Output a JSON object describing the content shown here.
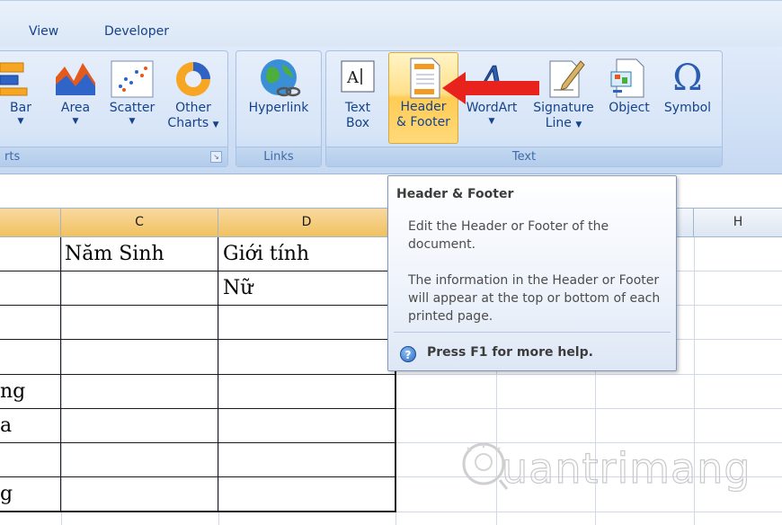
{
  "tabs": [
    "View",
    "Developer"
  ],
  "ribbon": {
    "charts_group": {
      "label": "rts",
      "buttons": [
        {
          "label": "Bar",
          "icon": "bar-chart-icon"
        },
        {
          "label": "Area",
          "icon": "area-chart-icon"
        },
        {
          "label": "Scatter",
          "icon": "scatter-chart-icon"
        },
        {
          "label": "Other",
          "label2": "Charts",
          "icon": "other-charts-icon"
        }
      ]
    },
    "links_group": {
      "label": "Links",
      "buttons": [
        {
          "label": "Hyperlink",
          "icon": "globe-link-icon"
        }
      ]
    },
    "text_group": {
      "label": "Text",
      "buttons": [
        {
          "label": "Text",
          "label2": "Box",
          "icon": "text-box-icon"
        },
        {
          "label": "Header",
          "label2": "& Footer",
          "icon": "header-footer-icon"
        },
        {
          "label": "WordArt",
          "icon": "wordart-icon"
        },
        {
          "label": "Signature",
          "label2": "Line",
          "icon": "signature-line-icon"
        },
        {
          "label": "Object",
          "icon": "object-icon"
        },
        {
          "label": "Symbol",
          "icon": "omega-icon",
          "glyph": "Ω"
        }
      ]
    }
  },
  "sheet": {
    "columns": [
      "C",
      "D",
      "H"
    ],
    "cells": {
      "c1": "Năm Sinh",
      "d1": "Giới tính",
      "d2": "Nữ",
      "a5": "ng",
      "a6": "a",
      "a8": "g"
    }
  },
  "tooltip": {
    "title": "Header & Footer",
    "body1": "Edit the Header or Footer of the document.",
    "body2": "The information in the Header or Footer will appear at the top or bottom of each printed page.",
    "help": "Press F1 for more help.",
    "help_glyph": "?"
  },
  "watermark": {
    "text": "uantrimang"
  },
  "colors": {
    "highlight": "#ffd76a",
    "arrow": "#e8231e",
    "ribbon_text": "#15428b"
  }
}
